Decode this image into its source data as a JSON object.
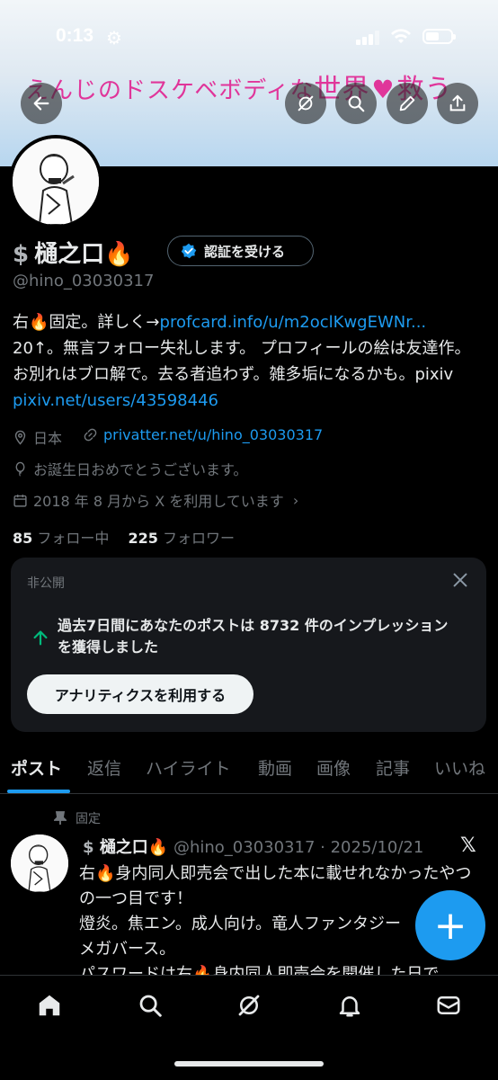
{
  "status_bar": {
    "time": "0:13"
  },
  "banner": {
    "text_left": "えんじのドスケベボディな",
    "text_right": "世界",
    "text_end": "救う",
    "heart": "♥"
  },
  "header_buttons": [
    "back-icon",
    "grok-icon",
    "search-icon",
    "edit-icon",
    "share-icon"
  ],
  "profile": {
    "name": "樋之口",
    "name_prefix": "$",
    "name_suffix": "🔥",
    "verify_label": "認証を受ける",
    "handle": "@hino_03030317",
    "bio_1": "右",
    "bio_2": "固定。詳しく→",
    "bio_link1": "profcard.info/u/m2oclKwgEWNr...",
    "bio_3": "20↑。無言フォロー失礼します。 プロフィールの絵は友達作。お別れはブロ解で。去る者追わず。雑多垢になるかも。pixiv ",
    "bio_link2": "pixiv.net/users/43598446",
    "location": "日本",
    "website": "privatter.net/u/hino_03030317",
    "birthday": "お誕生日おめでとうございます。",
    "joined": "2018 年 8 月から X を利用しています",
    "following_count": "85",
    "following_label": "フォロー中",
    "followers_count": "225",
    "followers_label": "フォロワー"
  },
  "analytics_card": {
    "label": "非公開",
    "text": "過去7日間にあなたのポストは 8732 件のインプレッションを獲得しました",
    "button": "アナリティクスを利用する"
  },
  "tabs": [
    "ポスト",
    "返信",
    "ハイライト",
    "動画",
    "画像",
    "記事",
    "いいね"
  ],
  "active_tab": 0,
  "pinned_post": {
    "pinned_label": "固定",
    "name": "樋之口",
    "name_prefix": "$",
    "name_suffix": "🔥",
    "handle": "@hino_03030317",
    "date": "2025/10/21",
    "line1_a": "右",
    "line1_b": "身内同人即売会で出した本に載せれなかったやつの一つ目です！",
    "line2": "燈炎。焦エン。成人向け。竜人ファンタジー",
    "line3": "メガバース。",
    "line4_a": "パスワードは右",
    "line4_b": "身内同人即売会を開催した日で"
  },
  "fab_label": "+",
  "colors": {
    "accent": "#1d9bf0",
    "bg": "#000000",
    "muted": "#71767b",
    "banner_pink": "#e0359a"
  }
}
